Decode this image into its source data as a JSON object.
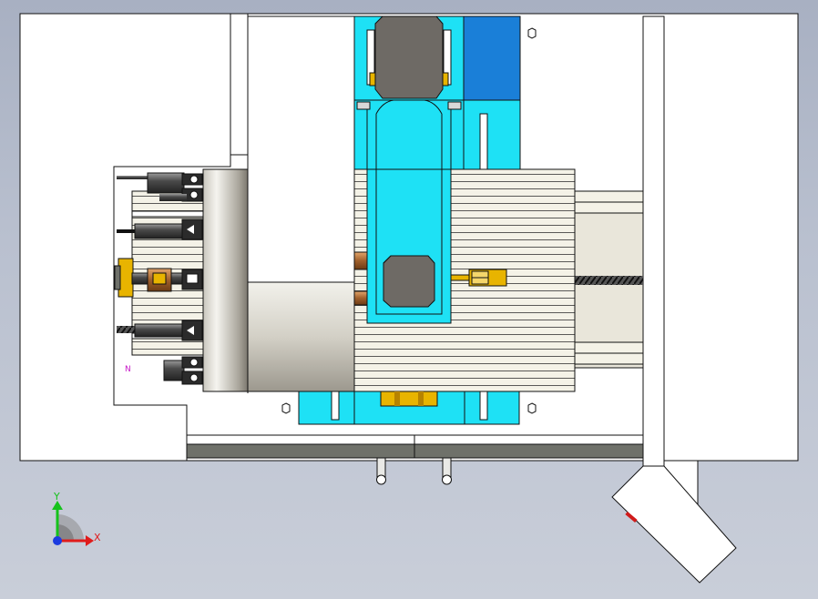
{
  "viewport": {
    "background_top": "#a8b0c2",
    "background_bottom": "#c9ced9"
  },
  "colors": {
    "cyan_part": "#1ee1f5",
    "blue_part": "#1a7fd8",
    "motor_grey": "#6e6a65",
    "brass": "#e8b400",
    "cream_panel": "#f3f1e6",
    "rail_grey": "#6c6f66",
    "outline": "#111111"
  },
  "triad": {
    "x_label": "X",
    "y_label": "Y",
    "z_label": "Z",
    "x_color": "#e01b1b",
    "y_color": "#15c21b",
    "z_color": "#1b3be0"
  },
  "annotations": {
    "magenta_mark": "N"
  }
}
